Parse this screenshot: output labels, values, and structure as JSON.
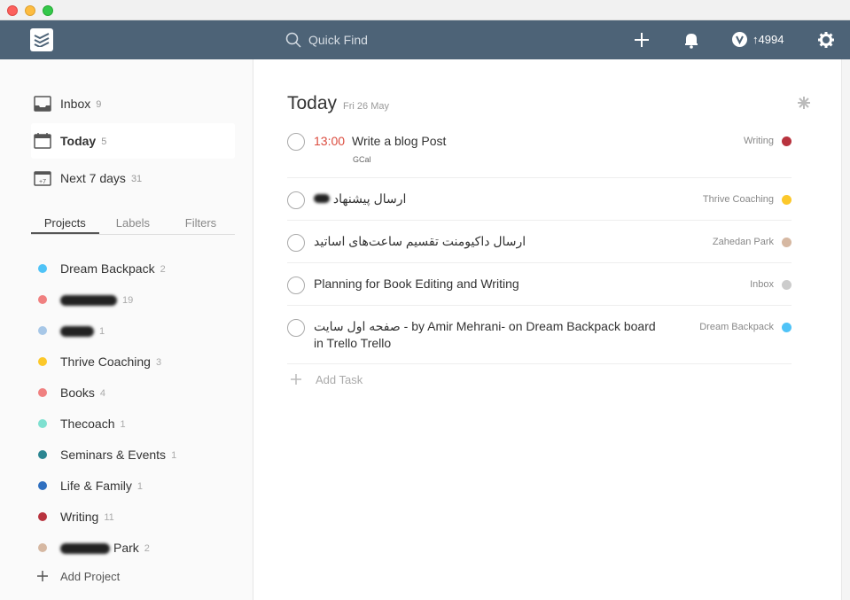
{
  "topbar": {
    "search_placeholder": "Quick Find",
    "karma": "4994"
  },
  "sidebar": {
    "nav": [
      {
        "label": "Inbox",
        "count": "9",
        "icon": "inbox-icon"
      },
      {
        "label": "Today",
        "count": "5",
        "icon": "calendar-icon"
      },
      {
        "label": "Next 7 days",
        "count": "31",
        "icon": "calendar-plus7-icon"
      }
    ],
    "tabs": [
      "Projects",
      "Labels",
      "Filters"
    ],
    "projects": [
      {
        "label": "Dream Backpack",
        "count": "2",
        "color": "#4fc3f7"
      },
      {
        "label": "",
        "count": "19",
        "color": "#f08080",
        "redacted": true
      },
      {
        "label": "",
        "count": "1",
        "color": "#a7c7e7",
        "redacted": true
      },
      {
        "label": "Thrive Coaching",
        "count": "3",
        "color": "#fcc82a"
      },
      {
        "label": "Books",
        "count": "4",
        "color": "#f08080"
      },
      {
        "label": "Thecoach",
        "count": "1",
        "color": "#7ee0d0"
      },
      {
        "label": "Seminars & Events",
        "count": "1",
        "color": "#2b8591"
      },
      {
        "label": "Life & Family",
        "count": "1",
        "color": "#2f6fbf"
      },
      {
        "label": "Writing",
        "count": "11",
        "color": "#b8333e"
      },
      {
        "label": "Park",
        "count": "2",
        "color": "#d6b8a2",
        "partially_redacted": true
      }
    ],
    "add_project": "Add Project"
  },
  "main": {
    "title": "Today",
    "date": "Fri 26 May",
    "tasks": [
      {
        "time": "13:00",
        "text": "Write a blog Post",
        "sub": "GCal",
        "project": "Writing",
        "color": "#b8333e"
      },
      {
        "time": "",
        "text": "ارسال پیشنهاد",
        "sub": "",
        "project": "Thrive Coaching",
        "color": "#fcc82a"
      },
      {
        "time": "",
        "text": "ارسال داکیومنت تقسیم ساعت‌های اساتید",
        "sub": "",
        "project": "Zahedan Park",
        "color": "#d6b8a2"
      },
      {
        "time": "",
        "text": "Planning for Book Editing and Writing",
        "sub": "",
        "project": "Inbox",
        "color": "#cccccc"
      },
      {
        "time": "",
        "text": "صفحه اول سایت - by Amir Mehrani- on Dream Backpack board in Trello Trello",
        "sub": "",
        "project": "Dream Backpack",
        "color": "#4fc3f7"
      }
    ],
    "add_task": "Add Task"
  }
}
